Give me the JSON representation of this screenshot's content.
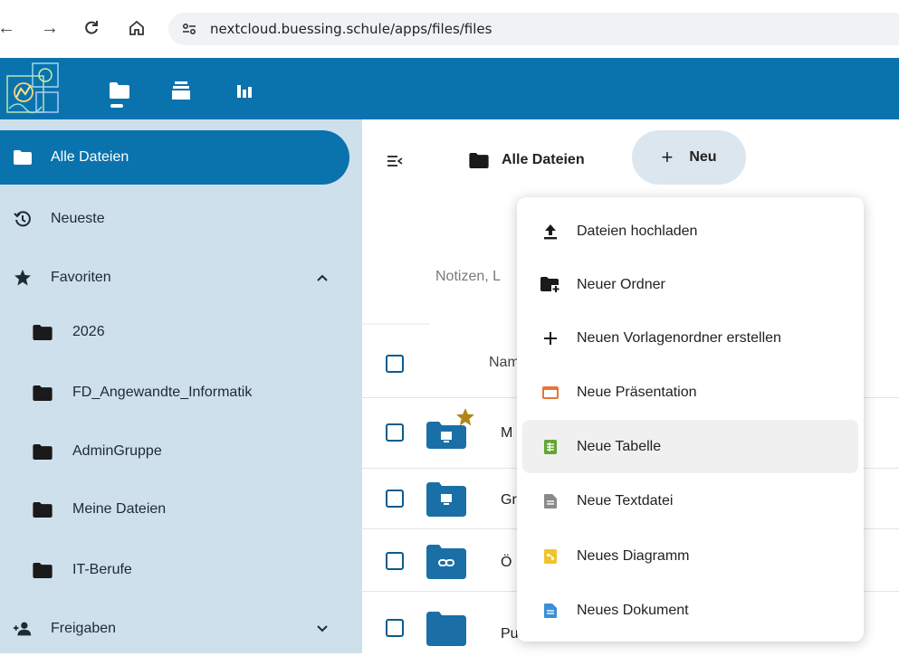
{
  "browser": {
    "url": "nextcloud.buessing.schule/apps/files/files"
  },
  "header": {
    "apps": [
      "files-icon",
      "activity-icon",
      "dashboard-icon"
    ]
  },
  "sidebar": {
    "items": [
      {
        "label": "Alle Dateien",
        "icon": "folder-icon",
        "active": true
      },
      {
        "label": "Neueste",
        "icon": "history-icon"
      },
      {
        "label": "Favoriten",
        "icon": "star-icon",
        "expanded": true
      },
      {
        "label": "2026",
        "icon": "folder-icon"
      },
      {
        "label": "FD_Angewandte_Informatik",
        "icon": "folder-icon"
      },
      {
        "label": "AdminGruppe",
        "icon": "folder-icon"
      },
      {
        "label": "Meine Dateien",
        "icon": "folder-icon"
      },
      {
        "label": "IT-Berufe",
        "icon": "folder-icon"
      },
      {
        "label": "Freigaben",
        "icon": "share-icon",
        "expanded": false
      }
    ]
  },
  "main": {
    "breadcrumb": "Alle Dateien",
    "new_button": "Neu",
    "notes_text": "Notizen, L",
    "column_name": "Nam",
    "rows": [
      {
        "name": "M",
        "folder_type": "group-folder",
        "favorite": true
      },
      {
        "name": "Gr",
        "folder_type": "group-folder",
        "favorite": false
      },
      {
        "name": "Ö",
        "folder_type": "link-folder",
        "favorite": false
      },
      {
        "name": "Public",
        "folder_type": "folder",
        "favorite": false
      }
    ]
  },
  "new_menu": {
    "items": [
      {
        "label": "Dateien hochladen",
        "icon": "upload-icon"
      },
      {
        "label": "Neuer Ordner",
        "icon": "folder-plus-icon"
      },
      {
        "label": "Neuen Vorlagenordner erstellen",
        "icon": "plus-icon"
      },
      {
        "label": "Neue Präsentation",
        "icon": "presentation-icon",
        "color": "#e8733a"
      },
      {
        "label": "Neue Tabelle",
        "icon": "spreadsheet-icon",
        "color": "#63a634",
        "hovered": true
      },
      {
        "label": "Neue Textdatei",
        "icon": "textfile-icon",
        "color": "#8a8a8a"
      },
      {
        "label": "Neues Diagramm",
        "icon": "diagram-icon",
        "color": "#f0c430"
      },
      {
        "label": "Neues Dokument",
        "icon": "document-icon",
        "color": "#3b8fd6"
      }
    ]
  },
  "colors": {
    "brand": "#0a73ad",
    "sidebar_bg": "#cde0ec",
    "star": "#b0861a"
  }
}
